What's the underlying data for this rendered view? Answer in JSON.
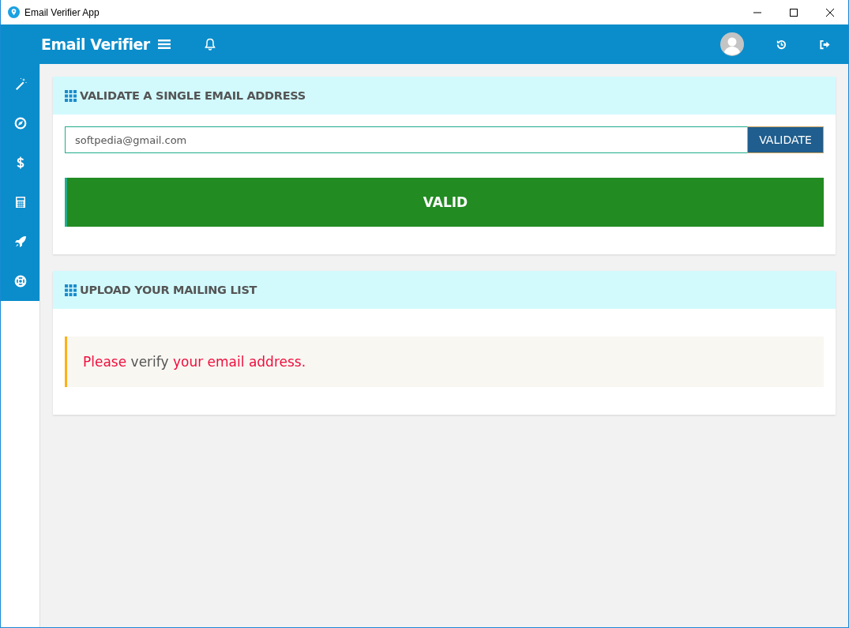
{
  "window": {
    "title": "Email Verifier App"
  },
  "header": {
    "brand": "Email Verifier"
  },
  "sidebar": {
    "items": [
      {
        "kind": "wand"
      },
      {
        "kind": "compass"
      },
      {
        "kind": "dollar"
      },
      {
        "kind": "calculator"
      },
      {
        "kind": "rocket"
      },
      {
        "kind": "lifebuoy"
      }
    ]
  },
  "validate_card": {
    "title": "VALIDATE A SINGLE EMAIL ADDRESS",
    "email": "softpedia@gmail.com",
    "button": "VALIDATE",
    "result": {
      "label": "VALID",
      "valid": true
    }
  },
  "upload_card": {
    "title": "UPLOAD YOUR MAILING LIST",
    "message": [
      {
        "text": "Please ",
        "muted": false
      },
      {
        "text": "verify",
        "muted": true
      },
      {
        "text": " your email address.",
        "muted": false
      }
    ]
  }
}
